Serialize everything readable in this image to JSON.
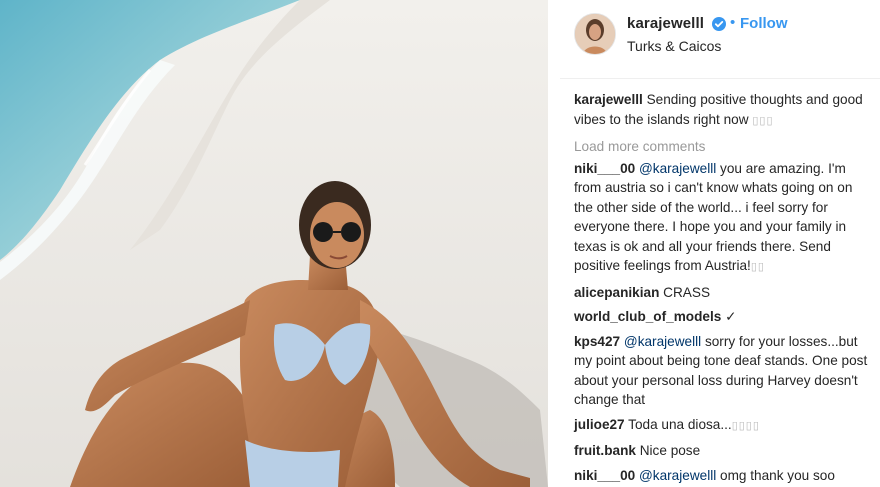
{
  "post": {
    "username": "karajewelll",
    "follow_label": "Follow",
    "separator": "•",
    "location": "Turks & Caicos"
  },
  "caption": {
    "username": "karajewelll",
    "text": "Sending positive thoughts and good vibes to the islands right now",
    "emoji": "▯▯▯"
  },
  "load_more": "Load more comments",
  "comments": [
    {
      "username": "niki___00",
      "mention": "@karajewelll",
      "text": "you are amazing. I'm from austria so i can't know whats going on on the other side of the world... i feel sorry for everyone there. I hope you and your family in texas is ok and all your friends there. Send positive feelings from Austria!",
      "emoji": "▯▯"
    },
    {
      "username": "alicepanikian",
      "mention": "",
      "text": "CRASS",
      "emoji": ""
    },
    {
      "username": "world_club_of_models",
      "mention": "",
      "text": "✓",
      "emoji": ""
    },
    {
      "username": "kps427",
      "mention": "@karajewelll",
      "text": "sorry for your losses...but my point about being tone deaf stands. One post about your personal loss during Harvey doesn't change that",
      "emoji": ""
    },
    {
      "username": "julioe27",
      "mention": "",
      "text": "Toda una diosa...",
      "emoji": "▯▯▯▯"
    },
    {
      "username": "fruit.bank",
      "mention": "",
      "text": "Nice pose",
      "emoji": ""
    },
    {
      "username": "niki___00",
      "mention": "@karajewelll",
      "text": "omg thank you soo",
      "emoji": ""
    }
  ],
  "colors": {
    "link": "#3897f0",
    "mention": "#003569",
    "muted": "#999999",
    "text": "#262626"
  },
  "icons": {
    "verified": "verified-badge-icon"
  }
}
